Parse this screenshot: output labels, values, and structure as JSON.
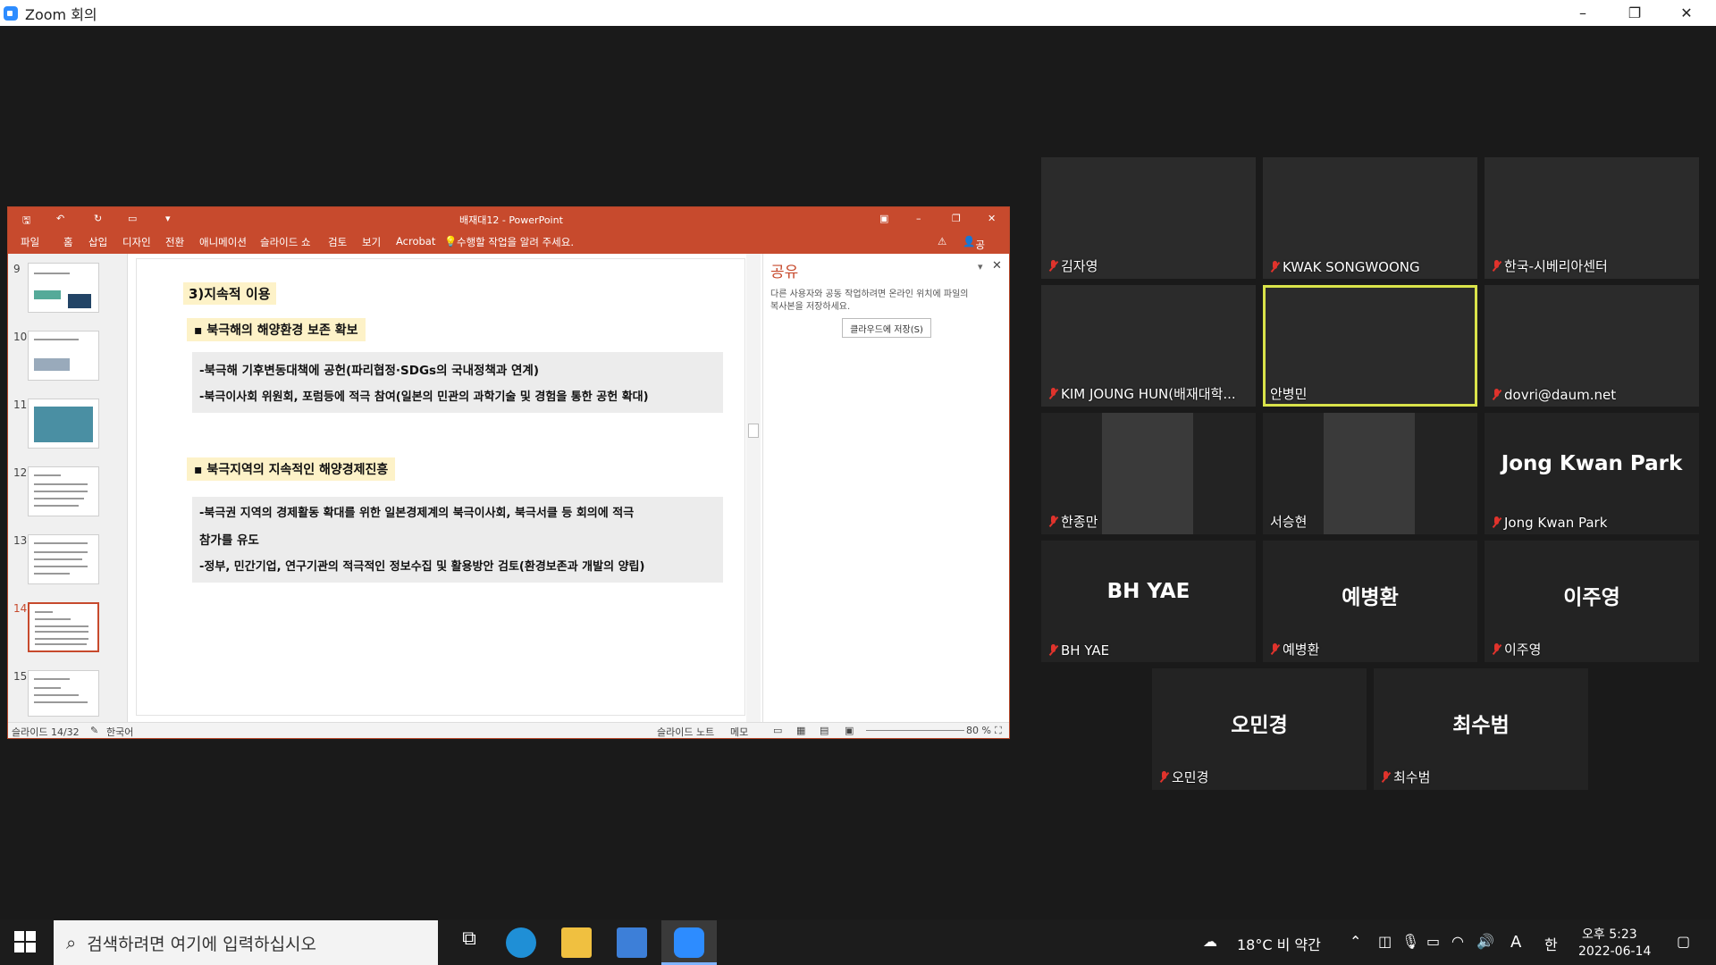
{
  "window": {
    "title": "Zoom 회의",
    "minimize": "–",
    "restore": "❐",
    "close": "✕"
  },
  "ppt": {
    "title": "배재대12 - PowerPoint",
    "menu": [
      "파일",
      "홈",
      "삽입",
      "디자인",
      "전환",
      "애니메이션",
      "슬라이드 쇼",
      "검토",
      "보기",
      "Acrobat"
    ],
    "tell_me": "수행할 작업을 알려 주세요.",
    "share_btn": "공유",
    "thumbs": [
      {
        "num": "9"
      },
      {
        "num": "10"
      },
      {
        "num": "11"
      },
      {
        "num": "12"
      },
      {
        "num": "13"
      },
      {
        "num": "14"
      },
      {
        "num": "15"
      }
    ],
    "slide": {
      "heading": "3)지속적 이용",
      "sec1_title": "▪ 북극해의 해양환경 보존 확보",
      "sec1_lines": [
        "-북극해 기후변동대책에 공헌(파리협정·SDGs의 국내정책과 연계)",
        "-북극이사회 위원회, 포럼등에 적극 참여(일본의 민관의 과학기술 및 경험을 통한 공헌 확대)"
      ],
      "sec2_title": "▪ 북극지역의 지속적인 해양경제진흥",
      "sec2_lines": [
        "-북극권 지역의 경제활동 확대를 위한 일본경제계의 북극이사회, 북극서클 등 회의에 적극",
        "참가를 유도",
        "-정부, 민간기업, 연구기관의 적극적인 정보수집 및 활용방안 검토(환경보존과 개발의 양립)"
      ]
    },
    "share_pane": {
      "title": "공유",
      "desc1": "다른 사용자와 공동 작업하려면 온라인 위치에 파일의",
      "desc2": "복사본을 저장하세요.",
      "button": "클라우드에 저장(S)"
    },
    "status": {
      "slide": "슬라이드 14/32",
      "lang": "한국어",
      "notes": "슬라이드 노트",
      "comments": "메모",
      "zoom": "80 %"
    }
  },
  "participants": [
    {
      "name": "김자영",
      "muted": true,
      "video": true
    },
    {
      "name": "KWAK SONGWOONG",
      "muted": true,
      "video": true
    },
    {
      "name": "한국-시베리아센터",
      "muted": true,
      "video": true
    },
    {
      "name": "KIM JOUNG HUN(배재대학...",
      "muted": true,
      "video": true
    },
    {
      "name": "안병민",
      "muted": false,
      "video": true,
      "active": true
    },
    {
      "name": "dovri@daum.net",
      "muted": true,
      "video": true
    },
    {
      "name": "한종만",
      "muted": true,
      "video": true
    },
    {
      "name": "서승현",
      "muted": false,
      "video": true
    },
    {
      "name": "Jong Kwan Park",
      "muted": true,
      "video": false,
      "big": "Jong Kwan Park"
    },
    {
      "name": "BH  YAE",
      "muted": true,
      "video": false,
      "big": "BH  YAE"
    },
    {
      "name": "예병환",
      "muted": true,
      "video": false,
      "big": "예병환"
    },
    {
      "name": "이주영",
      "muted": true,
      "video": false,
      "big": "이주영"
    },
    {
      "name": "오민경",
      "muted": true,
      "video": false,
      "big": "오민경"
    },
    {
      "name": "최수범",
      "muted": true,
      "video": false,
      "big": "최수범"
    }
  ],
  "taskbar": {
    "search_placeholder": "검색하려면 여기에 입력하십시오",
    "weather": "18°C  비 약간",
    "ime": "A",
    "ime2": "한",
    "time": "오후 5:23",
    "date": "2022-06-14"
  }
}
